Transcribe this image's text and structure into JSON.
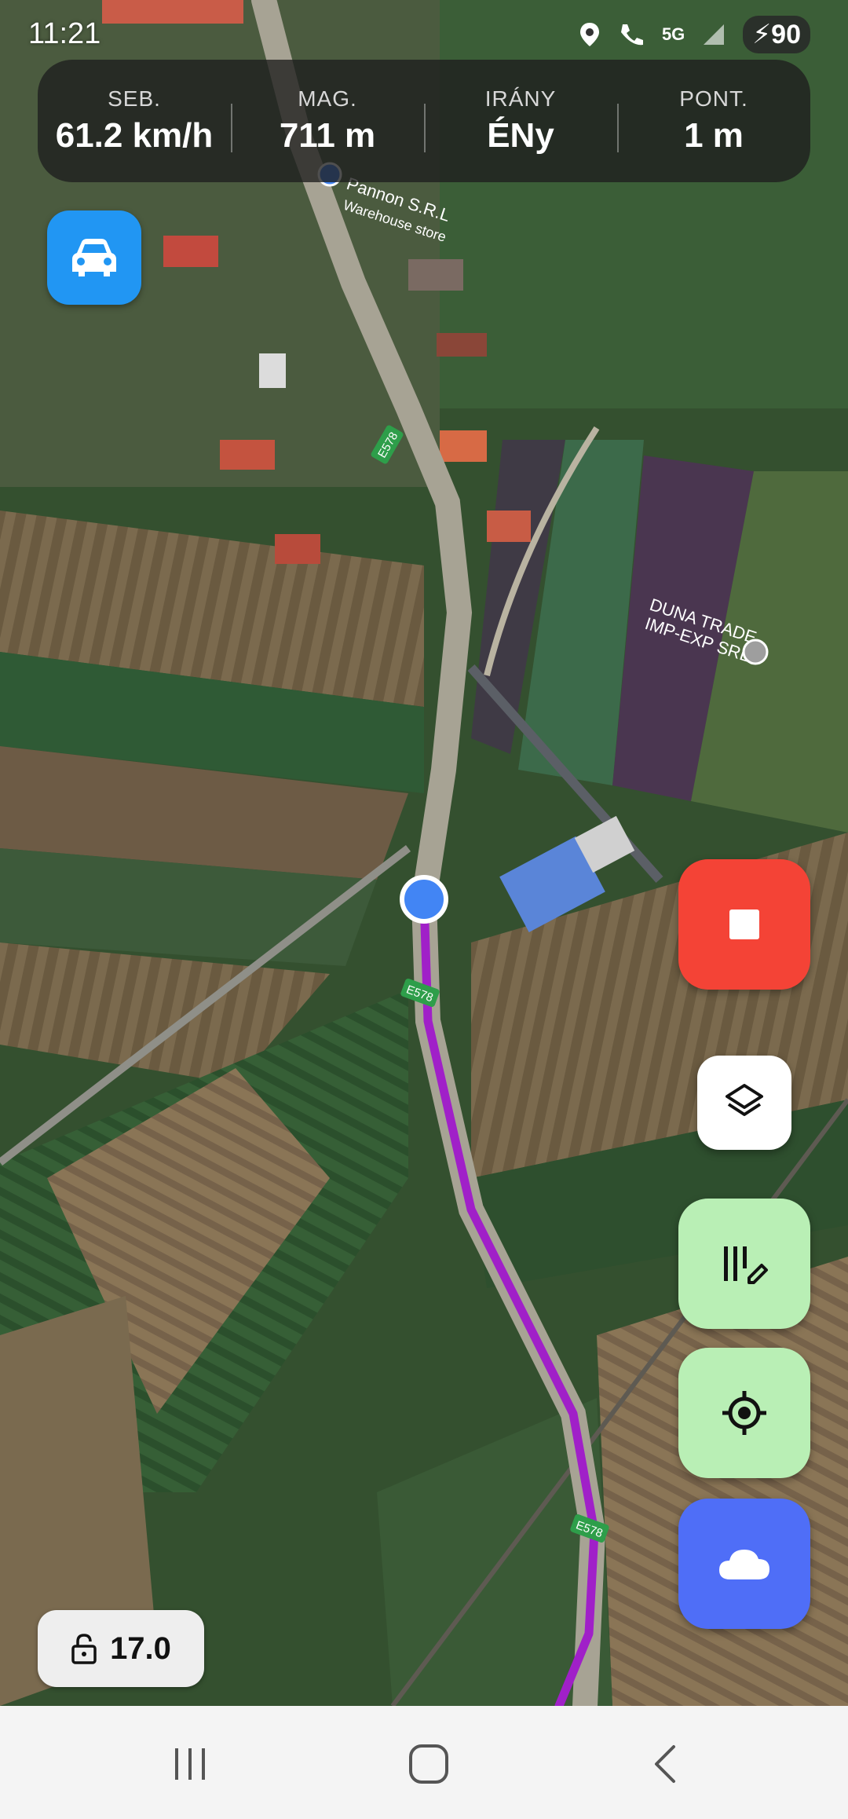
{
  "status_bar": {
    "time": "11:21",
    "network": "5G",
    "battery": "90",
    "icons": [
      "location-icon",
      "wifi-call-icon",
      "signal-icon",
      "battery-icon"
    ]
  },
  "stats": [
    {
      "label": "SEB.",
      "value": "61.2 km/h"
    },
    {
      "label": "MAG.",
      "value": "711 m"
    },
    {
      "label": "IRÁNY",
      "value": "ÉNy"
    },
    {
      "label": "PONT.",
      "value": "1 m"
    }
  ],
  "map": {
    "poi_pannon_name": "Pannon S.R.L",
    "poi_pannon_sub": "Warehouse store",
    "poi_duna_line1": "DUNA TRADE",
    "poi_duna_line2": "IMP-EXP SRL",
    "road_label": "E578",
    "track_color": "#a020c8",
    "position_color": "#4285f4"
  },
  "controls": {
    "mode_icon": "car-icon",
    "stop_color": "#f44336",
    "edit_color": "#b9efb5",
    "locate_color": "#b9efb5",
    "cloud_color": "#4f6ef7"
  },
  "zoom": {
    "value": "17.0",
    "icon": "lock-open-icon"
  },
  "nav": {
    "icons": [
      "recents-icon",
      "home-icon",
      "back-icon"
    ]
  }
}
